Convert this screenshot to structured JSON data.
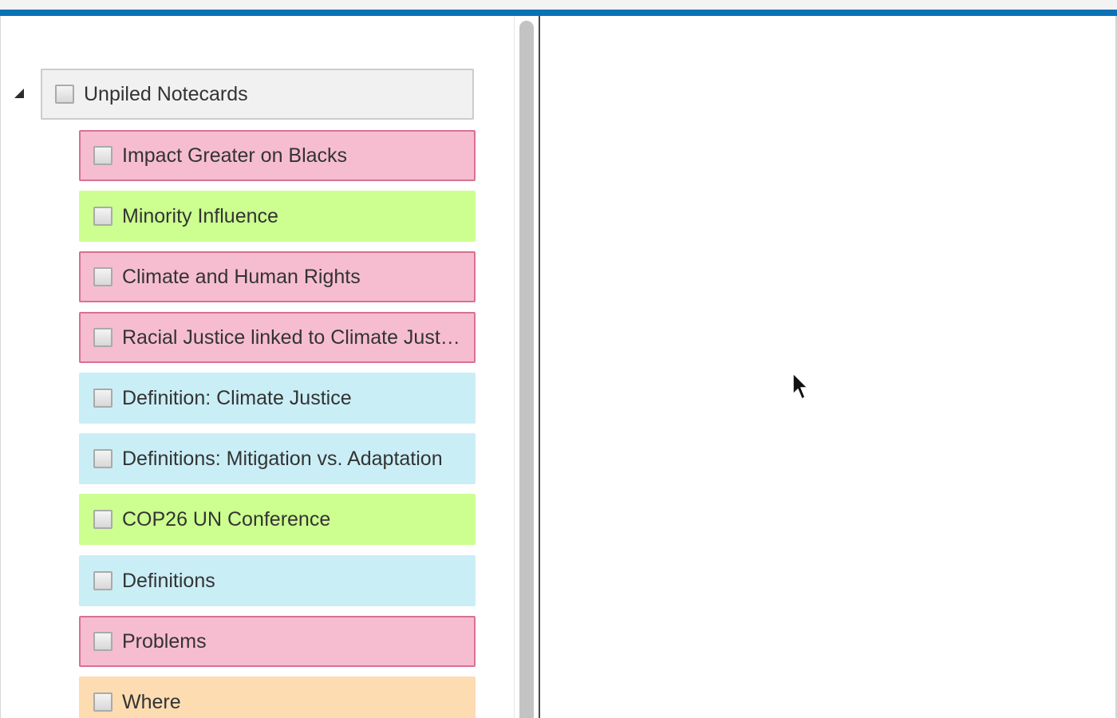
{
  "tree": {
    "toggle": "expanded",
    "root": {
      "label": "Unpiled Notecards"
    },
    "items": [
      {
        "label": "Impact Greater on Blacks",
        "color": "pink"
      },
      {
        "label": "Minority Influence",
        "color": "green"
      },
      {
        "label": "Climate and Human Rights",
        "color": "pink"
      },
      {
        "label": "Racial Justice linked to Climate Justice",
        "color": "pink"
      },
      {
        "label": "Definition: Climate Justice",
        "color": "blue"
      },
      {
        "label": "Definitions: Mitigation vs. Adaptation",
        "color": "blue"
      },
      {
        "label": "COP26 UN Conference",
        "color": "green"
      },
      {
        "label": "Definitions",
        "color": "blue"
      },
      {
        "label": "Problems",
        "color": "pink"
      },
      {
        "label": "Where",
        "color": "orange"
      }
    ]
  },
  "colors": {
    "accent": "#0a73b7",
    "pink": "#f6bdd1",
    "pink_border": "#d8718f",
    "green": "#ccff90",
    "blue": "#caeef6",
    "orange": "#fddcb1"
  }
}
